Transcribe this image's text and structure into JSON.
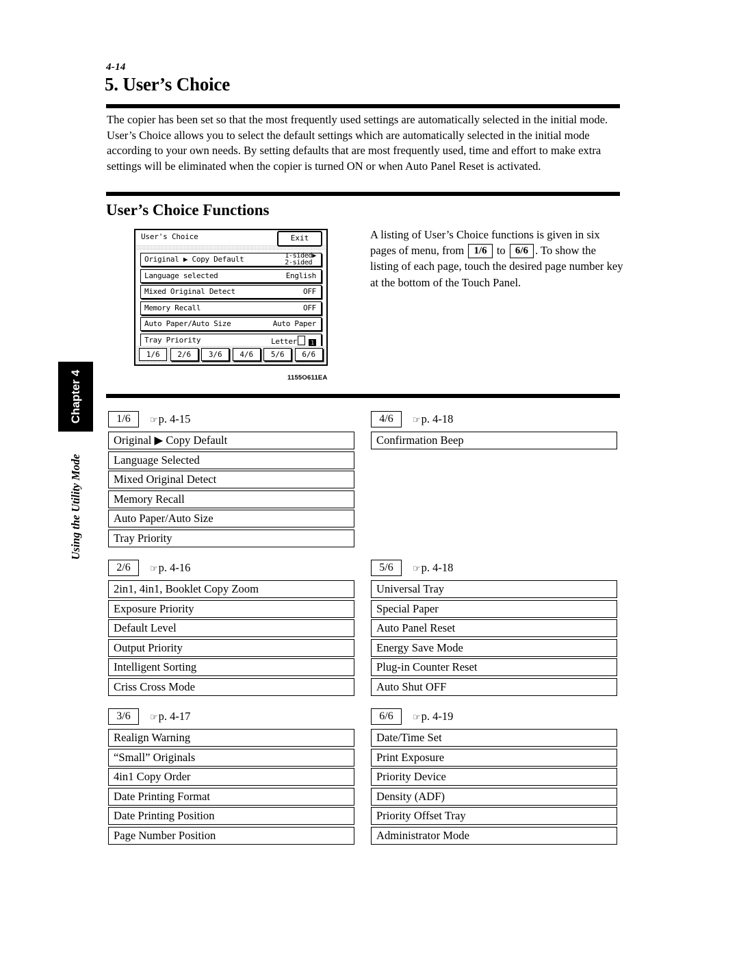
{
  "folio": "4-14",
  "heading": "5. User’s Choice",
  "intro_paragraph": "The copier has been set so that the most frequently used settings are automatically selected in the initial mode. User’s Choice allows you to select the default settings which are automatically selected in the initial mode according to your own needs. By setting defaults that are most frequently used, time and effort to make extra settings will be eliminated when the copier is turned ON or when Auto Panel Reset is activated.",
  "subheading": "User’s Choice Functions",
  "side_tab": {
    "chapter": "Chapter 4",
    "running_head": "Using the Utility Mode"
  },
  "figure_note": {
    "part1": "A listing of User’s Choice functions is given in six pages of menu, from",
    "key_from": "1/6",
    "mid": "to",
    "key_to": "6/6",
    "part2": ". To show the listing of each page, touch the desired page number key at the bottom of the Touch Panel."
  },
  "figure_code": "1155O611EA",
  "lcd": {
    "title": "User's Choice",
    "exit_label": "Exit",
    "rows": [
      {
        "label": "Original ▶ Copy Default",
        "value_line1": "1-sided▶",
        "value_line2": "2-sided",
        "two_line": true
      },
      {
        "label": "Language selected",
        "value": "English"
      },
      {
        "label": "Mixed Original Detect",
        "value": "OFF"
      },
      {
        "label": "Memory Recall",
        "value": "OFF"
      },
      {
        "label": "Auto Paper/Auto Size",
        "value": "Auto Paper"
      },
      {
        "label": "Tray Priority",
        "value": "Letter",
        "paper_icon": true,
        "tray_badge": "1"
      }
    ],
    "tabs": [
      "1/6",
      "2/6",
      "3/6",
      "4/6",
      "5/6",
      "6/6"
    ],
    "selected_tab": "1/6"
  },
  "groups": [
    {
      "key": "1/6",
      "ref": "p. 4-15",
      "items": [
        "Original ▶ Copy Default",
        "Language Selected",
        "Mixed Original Detect",
        "Memory Recall",
        "Auto Paper/Auto Size",
        "Tray Priority"
      ]
    },
    {
      "key": "2/6",
      "ref": "p. 4-16",
      "items": [
        "2in1, 4in1, Booklet Copy Zoom",
        "Exposure Priority",
        "Default Level",
        "Output Priority",
        "Intelligent Sorting",
        "Criss Cross Mode"
      ]
    },
    {
      "key": "3/6",
      "ref": "p. 4-17",
      "items": [
        "Realign Warning",
        "“Small” Originals",
        "4in1 Copy Order",
        "Date Printing Format",
        "Date Printing Position",
        "Page Number Position"
      ]
    },
    {
      "key": "4/6",
      "ref": "p. 4-18",
      "items": [
        "Confirmation Beep"
      ]
    },
    {
      "key": "5/6",
      "ref": "p. 4-18",
      "items": [
        "Universal Tray",
        "Special Paper",
        "Auto Panel Reset",
        "Energy Save Mode",
        "Plug-in Counter Reset",
        "Auto Shut OFF"
      ]
    },
    {
      "key": "6/6",
      "ref": "p. 4-19",
      "items": [
        "Date/Time Set",
        "Print Exposure",
        "Priority Device",
        "Density (ADF)",
        "Priority Offset Tray",
        "Administrator Mode"
      ]
    }
  ]
}
